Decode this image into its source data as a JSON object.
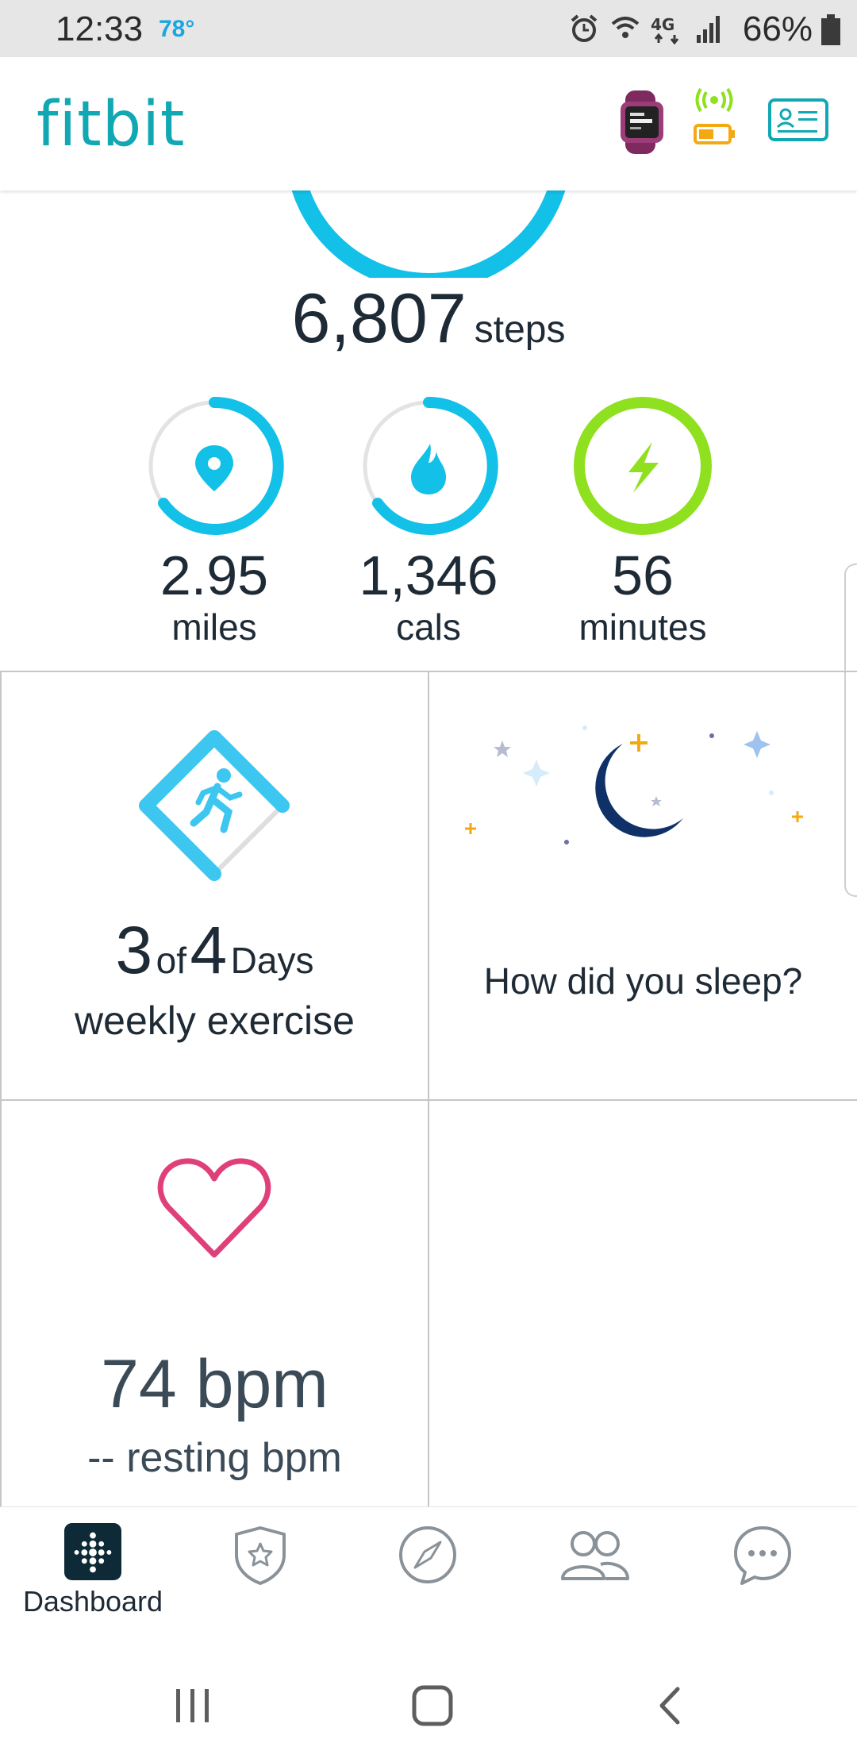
{
  "status_bar": {
    "time": "12:33",
    "temperature": "78°",
    "network": "4G LTE",
    "battery_percent": "66%"
  },
  "header": {
    "logo": "fitbit",
    "icons": [
      "watch-icon",
      "sync-signal-icon",
      "battery-icon",
      "profile-card-icon"
    ],
    "brand_color": "#12a8b3"
  },
  "dashboard": {
    "steps": {
      "value": "6,807",
      "unit": "steps"
    },
    "stats": [
      {
        "value": "2.95",
        "unit": "miles",
        "icon": "location-pin-icon",
        "progress": 0.62,
        "color": "#12c0e8"
      },
      {
        "value": "1,346",
        "unit": "cals",
        "icon": "flame-icon",
        "progress": 0.62,
        "color": "#12c0e8"
      },
      {
        "value": "56",
        "unit": "minutes",
        "icon": "lightning-icon",
        "progress": 1.0,
        "color": "#8fe01e"
      }
    ],
    "exercise": {
      "done": "3",
      "of": "of",
      "goal": "4",
      "days": "Days",
      "label": "weekly exercise"
    },
    "sleep": {
      "prompt": "How did you sleep?"
    },
    "heart": {
      "bpm": "74 bpm",
      "resting": "-- resting bpm",
      "color": "#e0407a"
    }
  },
  "bottom_nav": {
    "items": [
      {
        "label": "Dashboard",
        "icon": "dashboard-icon",
        "active": true
      },
      {
        "label": "",
        "icon": "challenges-star-badge-icon"
      },
      {
        "label": "",
        "icon": "discover-compass-icon"
      },
      {
        "label": "",
        "icon": "community-people-icon"
      },
      {
        "label": "",
        "icon": "chat-bubble-icon"
      }
    ]
  },
  "system_nav": {
    "icons": [
      "recent-apps-icon",
      "home-icon",
      "back-icon"
    ]
  }
}
